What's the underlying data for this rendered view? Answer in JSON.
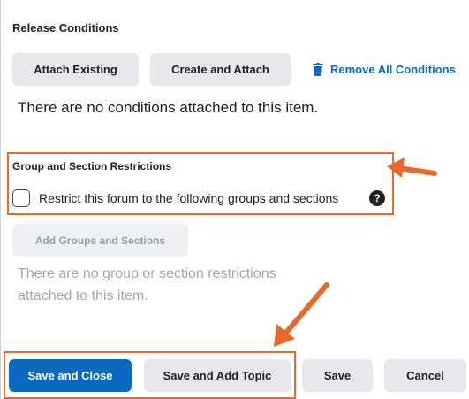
{
  "release": {
    "heading": "Release Conditions",
    "attach_existing_label": "Attach Existing",
    "create_attach_label": "Create and Attach",
    "remove_all_label": "Remove All Conditions",
    "no_conditions_text": "There are no conditions attached to this item."
  },
  "restrictions": {
    "heading": "Group and Section Restrictions",
    "checkbox_label": "Restrict this forum to the following groups and sections",
    "help_glyph": "?",
    "add_label": "Add Groups and Sections",
    "no_restrictions_line1": "There are no group or section restrictions",
    "no_restrictions_line2": "attached to this item."
  },
  "footer": {
    "save_close_label": "Save and Close",
    "save_add_topic_label": "Save and Add Topic",
    "save_label": "Save",
    "cancel_label": "Cancel"
  },
  "colors": {
    "accent": "#0b6ac0",
    "highlight": "#e66a2b"
  },
  "icons": {
    "trash": "trash-icon",
    "help": "help-icon",
    "arrow": "arrow-annotation"
  }
}
